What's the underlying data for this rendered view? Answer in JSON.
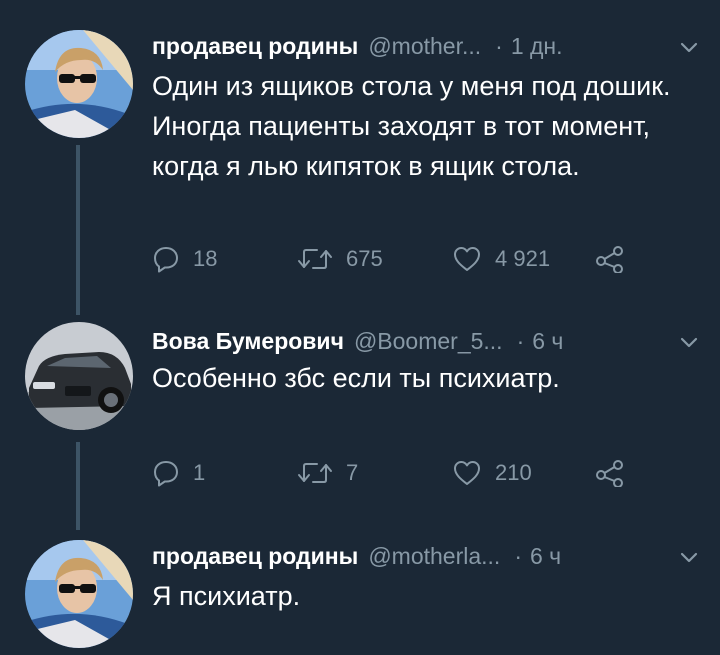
{
  "tweets": [
    {
      "name": "продавец родины",
      "handle": "@mother...",
      "time": "1 дн.",
      "text": "Один из ящиков стола у меня под дошик. Иногда пациенты заходят в тот момент, когда я лью кипяток в ящик стола.",
      "replies": "18",
      "retweets": "675",
      "likes": "4 921",
      "avatar": "person-with-sunglasses"
    },
    {
      "name": "Вова Бумерович",
      "handle": "@Boomer_5...",
      "time": "6 ч",
      "text": "Особенно збс если ты психиатр.",
      "replies": "1",
      "retweets": "7",
      "likes": "210",
      "avatar": "black-car"
    },
    {
      "name": "продавец родины",
      "handle": "@motherla...",
      "time": "6 ч",
      "text": "Я психиатр.",
      "avatar": "person-with-sunglasses"
    }
  ],
  "separator": "·",
  "colors": {
    "background": "#1b2836",
    "muted": "#8899a6",
    "thread_line": "#3d5466",
    "text": "#ffffff"
  },
  "icons": [
    "reply-icon",
    "retweet-icon",
    "like-icon",
    "share-icon",
    "chevron-down-icon"
  ]
}
